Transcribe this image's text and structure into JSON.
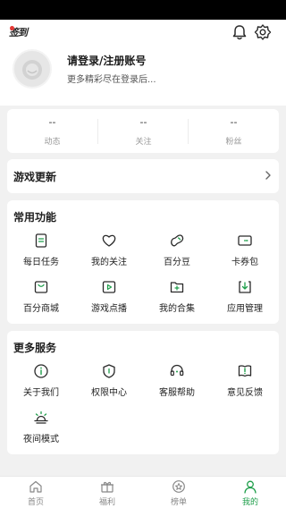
{
  "header": {
    "sign_icon_text": "签到",
    "login_title": "请登录/注册账号",
    "login_subtitle": "更多精彩尽在登录后..."
  },
  "stats": [
    {
      "value": "--",
      "label": "动态"
    },
    {
      "value": "--",
      "label": "关注"
    },
    {
      "value": "--",
      "label": "粉丝"
    }
  ],
  "game_update": {
    "title": "游戏更新"
  },
  "common_functions": {
    "title": "常用功能",
    "items": [
      {
        "label": "每日任务",
        "icon": "daily-task-icon"
      },
      {
        "label": "我的关注",
        "icon": "heart-icon"
      },
      {
        "label": "百分豆",
        "icon": "bean-icon"
      },
      {
        "label": "卡券包",
        "icon": "coupon-icon"
      },
      {
        "label": "百分商城",
        "icon": "shop-icon"
      },
      {
        "label": "游戏点播",
        "icon": "play-icon"
      },
      {
        "label": "我的合集",
        "icon": "folder-icon"
      },
      {
        "label": "应用管理",
        "icon": "download-icon"
      }
    ]
  },
  "more_services": {
    "title": "更多服务",
    "items": [
      {
        "label": "关于我们",
        "icon": "info-icon"
      },
      {
        "label": "权限中心",
        "icon": "shield-icon"
      },
      {
        "label": "客服帮助",
        "icon": "headset-icon"
      },
      {
        "label": "意见反馈",
        "icon": "feedback-icon"
      },
      {
        "label": "夜间模式",
        "icon": "sunset-icon"
      }
    ]
  },
  "tabbar": [
    {
      "label": "首页",
      "icon": "home-icon",
      "active": false
    },
    {
      "label": "福利",
      "icon": "gift-icon",
      "active": false
    },
    {
      "label": "榜单",
      "icon": "star-icon",
      "active": false
    },
    {
      "label": "我的",
      "icon": "user-icon",
      "active": true
    }
  ],
  "colors": {
    "accent": "#1e9e4a",
    "icon_stroke": "#2a2a2a",
    "background": "#f1f1f1"
  }
}
